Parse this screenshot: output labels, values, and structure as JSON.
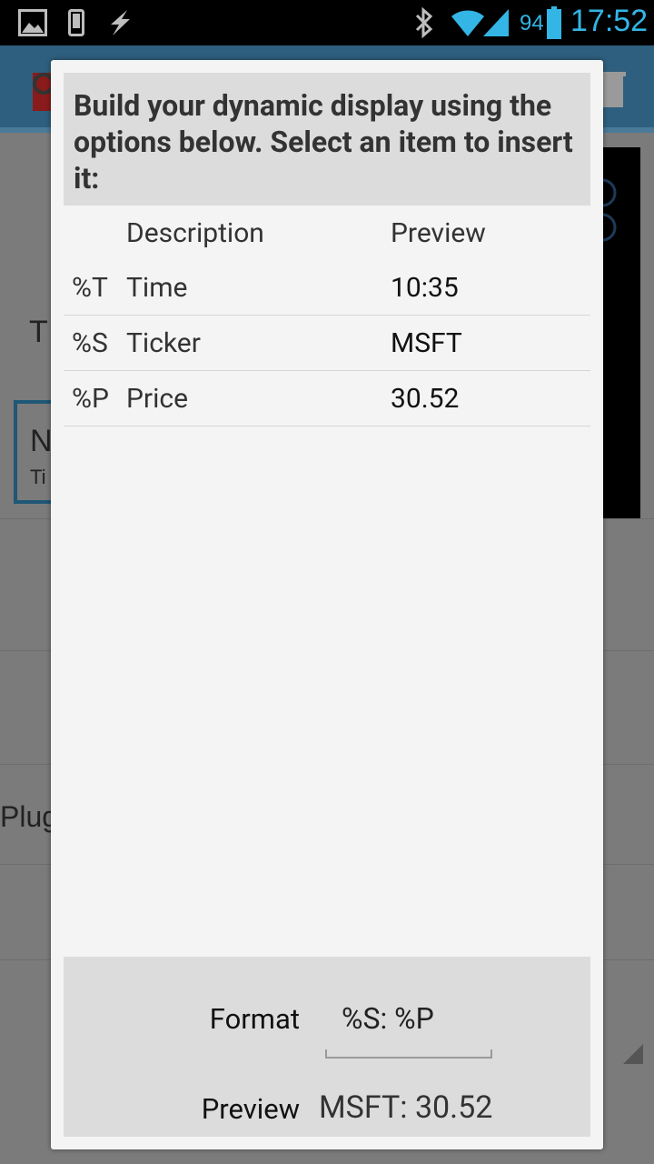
{
  "status_bar": {
    "battery_percent": "94",
    "time": "17:52",
    "accent_color": "#33b5e5"
  },
  "background": {
    "partial_label_1": "T",
    "partial_label_2": "N",
    "partial_label_3": "Ti",
    "partial_label_4": "Plug"
  },
  "dialog": {
    "title": "Build your dynamic display using the options below. Select an item to insert it:",
    "columns": {
      "code": "",
      "description": "Description",
      "preview": "Preview"
    },
    "rows": [
      {
        "code": "%T",
        "description": "Time",
        "preview": "10:35"
      },
      {
        "code": "%S",
        "description": "Ticker",
        "preview": "MSFT"
      },
      {
        "code": "%P",
        "description": "Price",
        "preview": "30.52"
      }
    ],
    "footer": {
      "format_label": "Format",
      "format_value": "%S: %P",
      "preview_label": "Preview",
      "preview_value": "MSFT: 30.52"
    }
  }
}
